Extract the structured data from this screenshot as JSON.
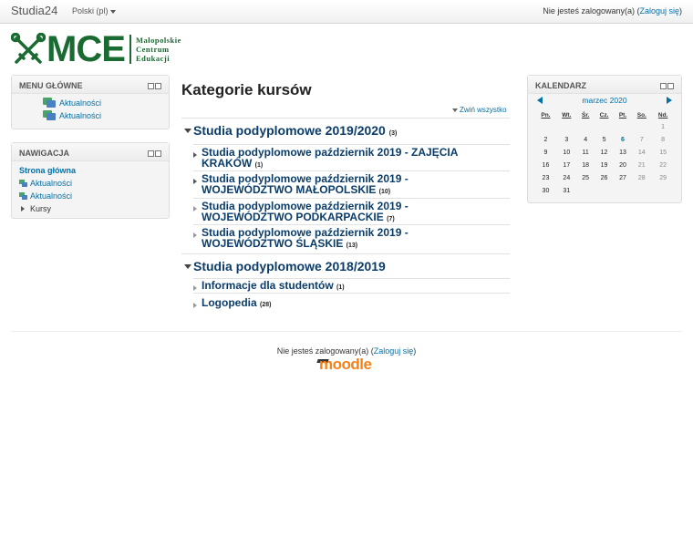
{
  "navbar": {
    "brand": "Studia24",
    "language": "Polski (pl)",
    "login_text": "Nie jesteś zalogowany(a) (",
    "login_link": "Zaloguj się",
    "login_close": ")"
  },
  "logo": {
    "text": "MCE",
    "line1": "Małopolskie",
    "line2": "Centrum",
    "line3": "Edukacji"
  },
  "main_menu": {
    "title": "MENU GŁÓWNE",
    "items": [
      "Aktualności",
      "Aktualności"
    ]
  },
  "navigation": {
    "title": "NAWIGACJA",
    "home": "Strona główna",
    "items": [
      "Aktualności",
      "Aktualności"
    ],
    "courses": "Kursy"
  },
  "content": {
    "title": "Kategorie kursów",
    "collapse_all": "Zwiń wszystko",
    "categories": [
      {
        "name": "Studia podyplomowe 2019/2020",
        "count": "(3)",
        "children": [
          {
            "name": "Studia podyplomowe październik 2019 - ZAJĘCIA KRAKÓW",
            "count": "(1)"
          },
          {
            "name": "Studia podyplomowe październik 2019 - WOJEWÓDZTWO MAŁOPOLSKIE",
            "count": "(10)"
          },
          {
            "name": "Studia podyplomowe październik 2019 - WOJEWÓDZTWO PODKARPACKIE",
            "count": "(7)"
          },
          {
            "name": "Studia podyplomowe październik 2019 - WOJEWÓDZTWO ŚLĄSKIE",
            "count": "(13)"
          }
        ]
      },
      {
        "name": "Studia podyplomowe 2018/2019",
        "count": "",
        "children": [
          {
            "name": "Informacje dla studentów",
            "count": "(1)"
          },
          {
            "name": "Logopedia",
            "count": "(28)"
          }
        ]
      }
    ]
  },
  "calendar": {
    "title": "KALENDARZ",
    "month": "marzec 2020",
    "weekdays": [
      "Pn.",
      "Wt.",
      "Śr.",
      "Cz.",
      "Pt.",
      "So.",
      "Nd."
    ],
    "weeks": [
      [
        "",
        "",
        "",
        "",
        "",
        "",
        "1"
      ],
      [
        "2",
        "3",
        "4",
        "5",
        "6",
        "7",
        "8"
      ],
      [
        "9",
        "10",
        "11",
        "12",
        "13",
        "14",
        "15"
      ],
      [
        "16",
        "17",
        "18",
        "19",
        "20",
        "21",
        "22"
      ],
      [
        "23",
        "24",
        "25",
        "26",
        "27",
        "28",
        "29"
      ],
      [
        "30",
        "31",
        "",
        "",
        "",
        "",
        ""
      ]
    ],
    "today": "6"
  },
  "footer": {
    "login_text": "Nie jesteś zalogowany(a) (",
    "login_link": "Zaloguj się",
    "login_close": ")",
    "moodle": "moodle"
  },
  "colors": {
    "brand_green": "#1a6b32",
    "link_blue": "#0070a8",
    "category_blue": "#0b3d6b",
    "moodle_orange": "#f98012"
  }
}
